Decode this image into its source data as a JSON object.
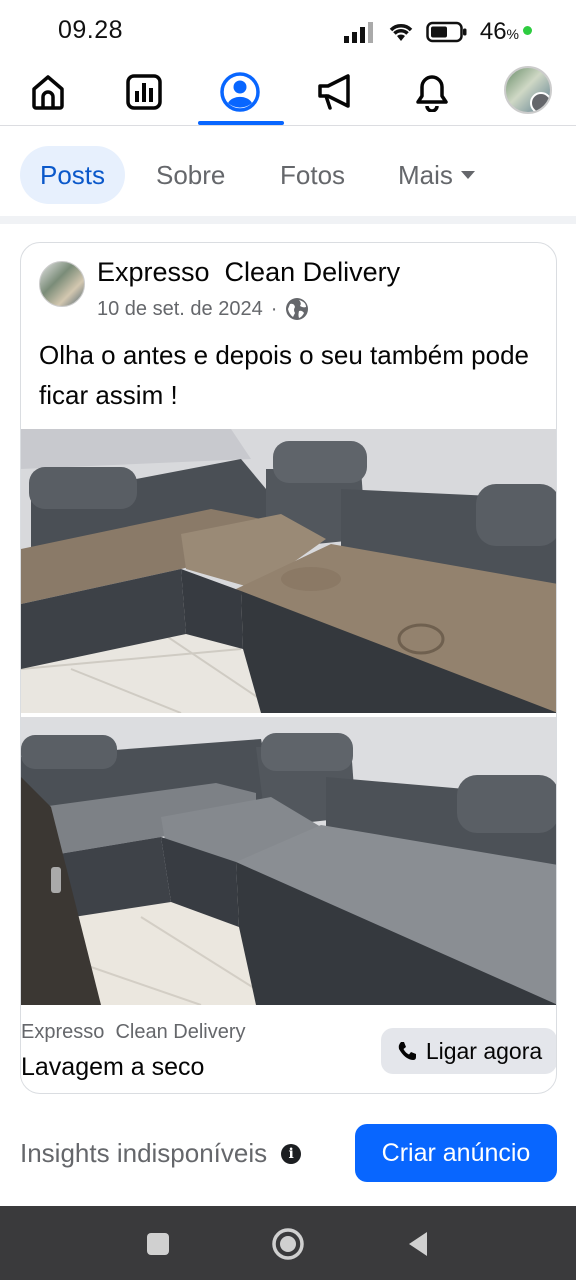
{
  "status_bar": {
    "time": "09.28",
    "battery": "46",
    "battery_unit": "%"
  },
  "nav": {
    "items": [
      {
        "icon": "home-icon"
      },
      {
        "icon": "dashboard-icon"
      },
      {
        "icon": "profile-icon",
        "active": true
      },
      {
        "icon": "megaphone-icon"
      },
      {
        "icon": "bell-icon"
      },
      {
        "icon": "profile-menu-thumbnail"
      }
    ],
    "accent": "#0866ff"
  },
  "tabs": {
    "posts": "Posts",
    "about": "Sobre",
    "photos": "Fotos",
    "more": "Mais"
  },
  "post": {
    "author": "Expresso  Clean Delivery",
    "date": "10 de set. de 2024",
    "separator": "·",
    "audience_icon": "globe-icon",
    "text": "Olha o antes e depois o seu também pode ficar assim !",
    "photos": [
      {
        "kind": "before",
        "description_icon": "stained-sofa-photo"
      },
      {
        "kind": "after",
        "description_icon": "clean-sofa-photo"
      }
    ]
  },
  "ad": {
    "source": "Expresso  Clean Delivery",
    "title": "Lavagem a seco",
    "call_button": "Ligar agora"
  },
  "footer": {
    "insights": "Insights indisponíveis",
    "cta": "Criar anúncio"
  },
  "colors": {
    "primary": "#0866ff",
    "tab_active_bg": "#e7f0fd",
    "muted": "#65676b"
  }
}
